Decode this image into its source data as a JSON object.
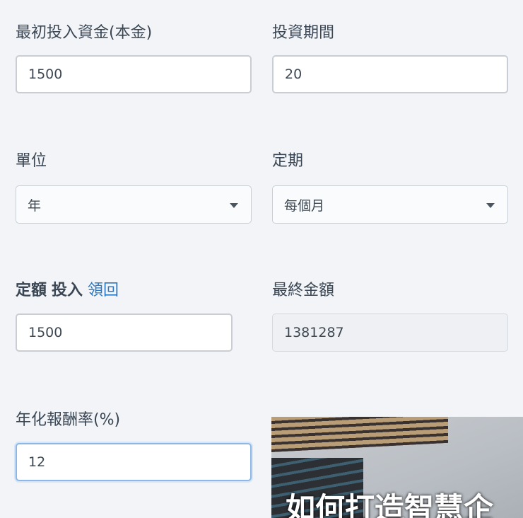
{
  "initial": {
    "label": "最初投入資金(本金)",
    "value": "1500"
  },
  "period": {
    "label": "投資期間",
    "value": "20"
  },
  "unit": {
    "label": "單位",
    "value": "年"
  },
  "frequency": {
    "label": "定期",
    "value": "每個月"
  },
  "fixed": {
    "label_a": "定額",
    "label_b": "投入",
    "label_link": "領回",
    "value": "1500"
  },
  "final": {
    "label": "最終金額",
    "value": "1381287"
  },
  "rate": {
    "label": "年化報酬率(%)",
    "value": "12"
  },
  "ad": {
    "caption": "如何打造智慧企"
  }
}
